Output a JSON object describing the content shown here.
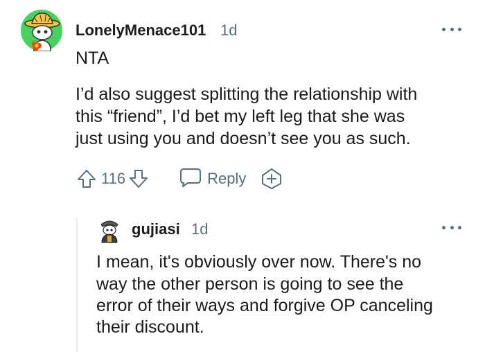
{
  "comment": {
    "username": "LonelyMenace101",
    "timestamp": "1d",
    "body_lines": [
      "NTA",
      "I’d also suggest splitting the relationship with",
      "this “friend”, I’d bet my left leg that she was",
      "just using you and doesn’t see you as such."
    ],
    "score": "116",
    "reply_label": "Reply"
  },
  "reply": {
    "username": "gujiasi",
    "timestamp": "1d",
    "body_lines": [
      "I mean, it's obviously over now. There's no",
      "way the other person is going to see the",
      "error of their ways and forgive OP canceling",
      "their discount."
    ]
  },
  "icons": {
    "upvote": "upvote-arrow-icon",
    "downvote": "downvote-arrow-icon",
    "reply": "speech-bubble-icon",
    "award": "award-plus-icon",
    "more": "more-options-icon"
  },
  "colors": {
    "meta_gray": "#576f76",
    "avatar_green": "#46d160",
    "thread_line": "#e5e9eb"
  }
}
